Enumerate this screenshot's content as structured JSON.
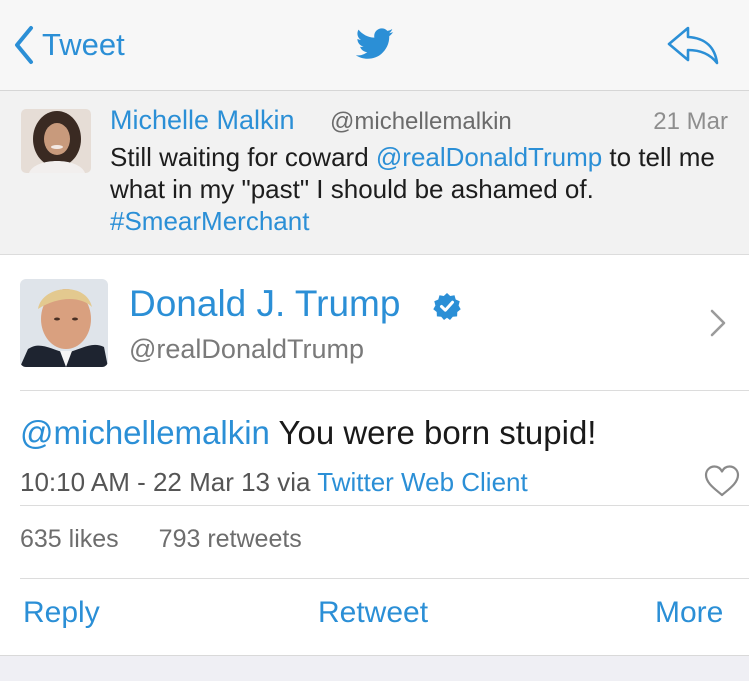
{
  "nav": {
    "back_label": "Tweet",
    "brand_icon": "twitter-bird-icon",
    "reply_icon": "reply-arrow-icon",
    "accent": "#2b8fd6"
  },
  "parent_tweet": {
    "name": "Michelle Malkin",
    "handle": "@michellemalkin",
    "date": "21 Mar",
    "text_parts": {
      "a": "Still waiting for coward ",
      "mention": "@realDonaldTrump",
      "b": " to tell me what in my \"past\" I should be ashamed of. ",
      "hashtag": "#SmearMerchant"
    }
  },
  "author": {
    "name": "Donald J. Trump",
    "handle": "@realDonaldTrump",
    "verified_icon": "verified-badge-icon"
  },
  "tweet": {
    "mention": "@michellemalkin",
    "text": " You were born stupid!",
    "timestamp": "10:10 AM - 22 Mar 13 via ",
    "client": "Twitter Web Client"
  },
  "stats": {
    "likes": "635 likes",
    "retweets": "793 retweets"
  },
  "actions": {
    "reply": "Reply",
    "retweet": "Retweet",
    "more": "More"
  }
}
